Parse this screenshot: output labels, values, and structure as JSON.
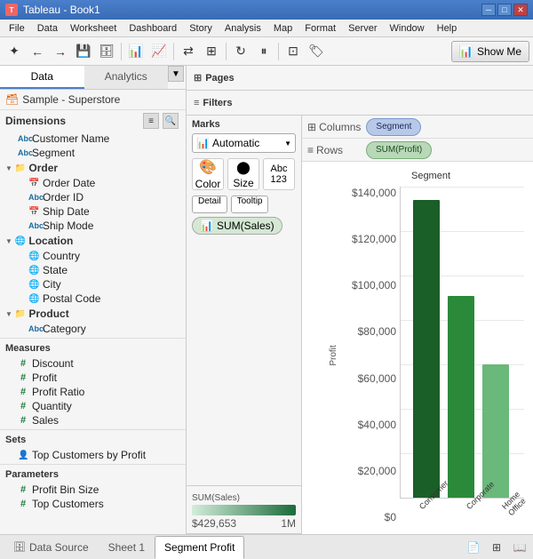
{
  "titleBar": {
    "title": "Tableau - Book1",
    "minBtn": "─",
    "maxBtn": "□",
    "closeBtn": "✕"
  },
  "menuBar": {
    "items": [
      "File",
      "Data",
      "Worksheet",
      "Dashboard",
      "Story",
      "Analysis",
      "Map",
      "Format",
      "Server",
      "Window",
      "Help"
    ]
  },
  "toolbar": {
    "showMeLabel": "Show Me"
  },
  "leftPanel": {
    "dataTab": "Data",
    "analyticsTab": "Analytics",
    "dataSource": "Sample - Superstore",
    "dimensionsLabel": "Dimensions",
    "fields": {
      "customer": "Customer Name",
      "segment": "Segment",
      "orderGroup": "Order",
      "orderDate": "Order Date",
      "orderID": "Order ID",
      "shipDate": "Ship Date",
      "shipMode": "Ship Mode",
      "locationGroup": "Location",
      "country": "Country",
      "state": "State",
      "city": "City",
      "postalCode": "Postal Code",
      "productGroup": "Product",
      "category": "Category"
    },
    "measuresLabel": "Measures",
    "measures": [
      "Discount",
      "Profit",
      "Profit Ratio",
      "Quantity",
      "Sales"
    ],
    "setsLabel": "Sets",
    "sets": [
      "Top Customers by Profit"
    ],
    "parametersLabel": "Parameters",
    "parameters": [
      "Profit Bin Size",
      "Top Customers"
    ]
  },
  "pages": {
    "label": "Pages"
  },
  "filters": {
    "label": "Filters"
  },
  "marks": {
    "label": "Marks",
    "dropdownValue": "Automatic",
    "colorLabel": "Color",
    "sizeLabel": "Size",
    "labelLabel": "Label",
    "detailLabel": "Detail",
    "tooltipLabel": "Tooltip",
    "pill": "SUM(Sales)",
    "colorLegendTitle": "SUM(Sales)",
    "colorMin": "$429,653",
    "colorMax": "1M"
  },
  "shelves": {
    "columnsLabel": "Columns",
    "columnsPill": "Segment",
    "rowsLabel": "Rows",
    "rowsPill": "SUM(Profit)"
  },
  "chart": {
    "title": "Segment",
    "yAxisLabels": [
      "$140,000",
      "$120,000",
      "$100,000",
      "$80,000",
      "$60,000",
      "$40,000",
      "$20,000",
      "$0"
    ],
    "yLabel": "Profit",
    "bars": [
      {
        "label": "Consumer",
        "value": 134000,
        "color": "#1a6b2a"
      },
      {
        "label": "Corporate",
        "value": 91000,
        "color": "#2a8a3a"
      },
      {
        "label": "Home Office",
        "color": "#6ab87a",
        "value": 60000
      }
    ],
    "maxValue": 140000
  },
  "statusBar": {
    "datasourceTab": "Data Source",
    "sheet1Tab": "Sheet 1",
    "activeTab": "Segment Profit"
  }
}
